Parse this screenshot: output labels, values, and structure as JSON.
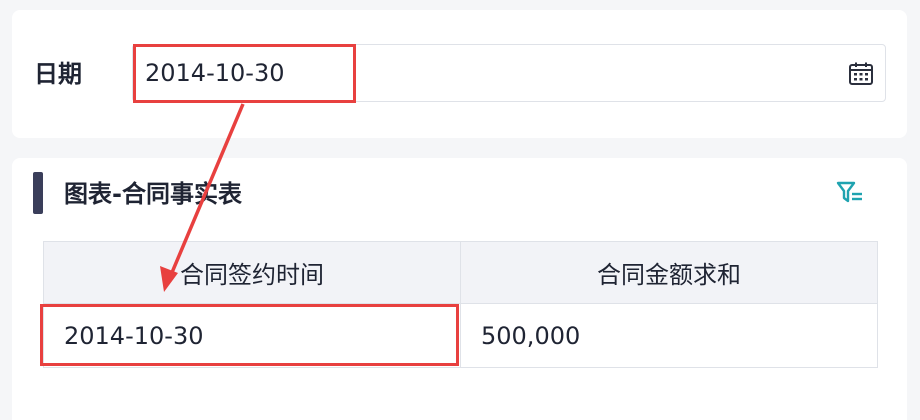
{
  "filter": {
    "label": "日期",
    "date_value": "2014-10-30"
  },
  "chart": {
    "title": "图表-合同事实表",
    "columns": [
      "合同签约时间",
      "合同金额求和"
    ],
    "rows": [
      [
        "2014-10-30",
        "500,000"
      ]
    ]
  },
  "icons": {
    "calendar": "calendar-icon",
    "filter": "filter-settings-icon"
  },
  "colors": {
    "accent": "#1fa3b0",
    "title_bar": "#3a3e5a",
    "annotation": "#e8403f"
  }
}
